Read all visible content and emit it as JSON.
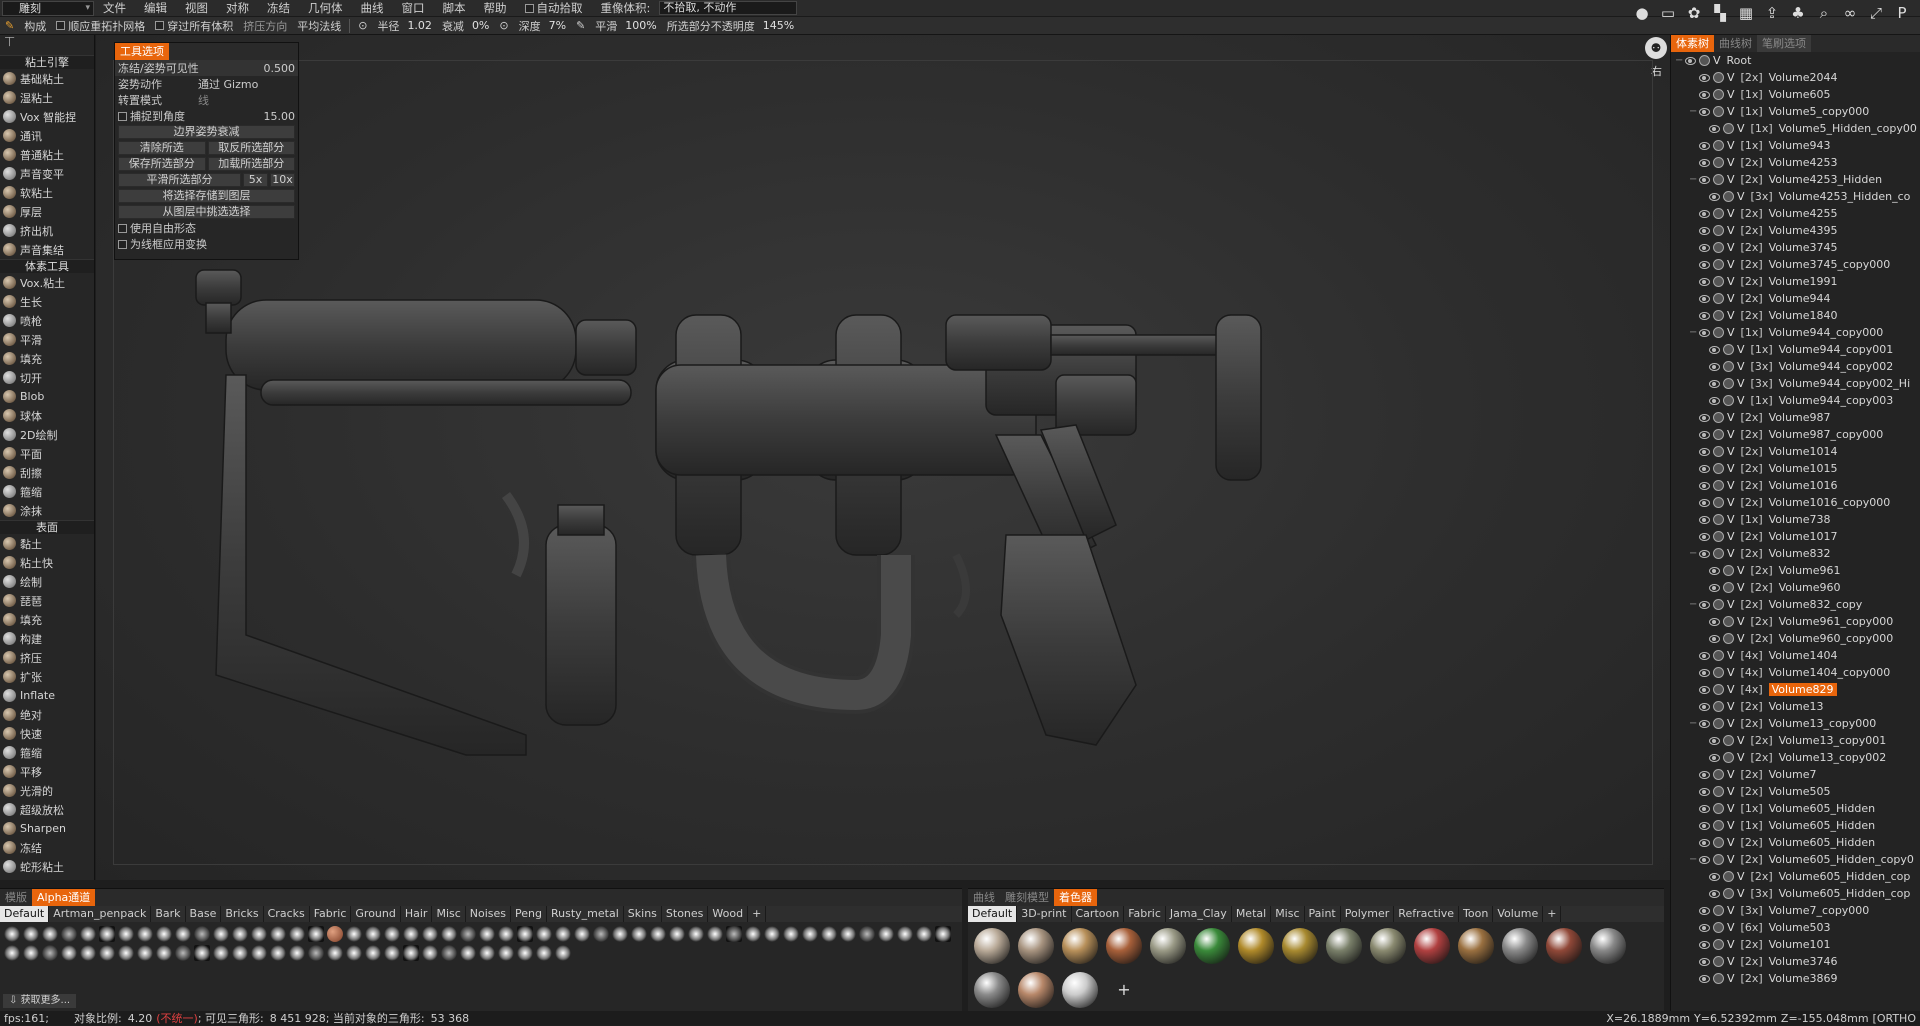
{
  "menubar": {
    "mode": "雕刻",
    "items": [
      "文件",
      "编辑",
      "视图",
      "对称",
      "冻结",
      "几何体",
      "曲线",
      "窗口",
      "脚本",
      "帮助"
    ],
    "auto_pick_label": "自动拾取",
    "reset_volume_label": "重像体积:",
    "reset_volume_value": "不拾取, 不动作"
  },
  "toolopts": {
    "construct": "构成",
    "adapt_topology": "顺应重拓扑网格",
    "through_all": "穿过所有体积",
    "extrude_dir": "挤压方向",
    "average_plane": "平均法线",
    "radius_label": "半径",
    "radius_value": "1.02",
    "falloff_label": "衰减",
    "falloff_value": "0%",
    "depth_label": "深度",
    "depth_value": "7%",
    "smooth_label": "平滑",
    "smooth_value": "100%",
    "opacity_label": "所选部分不透明度",
    "opacity_value": "145%"
  },
  "right_icon_names": [
    "sphere-icon",
    "rect-icon",
    "brush-icon",
    "checker-icon",
    "grid-icon",
    "export-icon",
    "paint-icon",
    "zoom-icon",
    "link-icon",
    "mirror-icon",
    "p-icon"
  ],
  "leftpanel": {
    "clay_header": "粘土引擎",
    "clay_brushes": [
      "基础粘土",
      "湿粘土",
      "Vox 智能捏",
      "通讯",
      "普通粘土",
      "声音变平",
      "软粘土",
      "厚层",
      "挤出机",
      "声音集结"
    ],
    "voxel_header": "体素工具",
    "voxel_brushes": [
      "Vox.粘土",
      "生长",
      "喷枪",
      "平滑",
      "填充",
      "切开",
      "Blob",
      "球体",
      "2D绘制",
      "平面",
      "刮擦",
      "箍缩",
      "涂抹"
    ],
    "surface_header": "表面",
    "surface_brushes": [
      "黏土",
      "粘土快",
      "绘制",
      "琵琶",
      "填充",
      "构建",
      "挤压",
      "扩张",
      "Inflate",
      "绝对",
      "快速",
      "箍缩",
      "平移",
      "光滑的",
      "超级放松",
      "Sharpen",
      "冻结",
      "蛇形粘土"
    ]
  },
  "tool_options_panel": {
    "tab": "工具选项",
    "freeze_label": "冻结/姿势可见性",
    "freeze_value": "0.500",
    "pose_action_label": "姿势动作",
    "pose_action_value": "通过 Gizmo",
    "transform_mode_label": "转置模式",
    "transform_mode_value": "线",
    "snap_angle_label": "捕捉到角度",
    "snap_angle_value": "15.00",
    "border_falloff": "边界姿势衰减",
    "clear_sel": "清除所选",
    "invert_sel": "取反所选部分",
    "save_sel": "保存所选部分",
    "load_sel": "加载所选部分",
    "smooth_sel": "平滑所选部分",
    "x5": "5x",
    "x10": "10x",
    "store_layer": "将选择存储到图层",
    "pick_layer": "从图层中挑选选择",
    "free_form": "使用自由形态",
    "wire_transform": "为线框应用变换"
  },
  "viewport": {
    "view_label": "右"
  },
  "rightpanel": {
    "tabs": [
      "体素树",
      "曲线树",
      "笔刷选项"
    ],
    "root": "Root",
    "items": [
      {
        "mult": "[2x]",
        "name": "Volume2044",
        "indent": 0
      },
      {
        "mult": "[1x]",
        "name": "Volume605",
        "indent": 0
      },
      {
        "mult": "[1x]",
        "name": "Volume5_copy000",
        "indent": 0,
        "collapse": true
      },
      {
        "mult": "[1x]",
        "name": "Volume5_Hidden_copy00",
        "indent": 1
      },
      {
        "mult": "[1x]",
        "name": "Volume943",
        "indent": 0
      },
      {
        "mult": "[2x]",
        "name": "Volume4253",
        "indent": 0
      },
      {
        "mult": "[2x]",
        "name": "Volume4253_Hidden",
        "indent": 0,
        "collapse": true
      },
      {
        "mult": "[3x]",
        "name": "Volume4253_Hidden_co",
        "indent": 1
      },
      {
        "mult": "[2x]",
        "name": "Volume4255",
        "indent": 0
      },
      {
        "mult": "[2x]",
        "name": "Volume4395",
        "indent": 0
      },
      {
        "mult": "[2x]",
        "name": "Volume3745",
        "indent": 0
      },
      {
        "mult": "[2x]",
        "name": "Volume3745_copy000",
        "indent": 0
      },
      {
        "mult": "[2x]",
        "name": "Volume1991",
        "indent": 0
      },
      {
        "mult": "[2x]",
        "name": "Volume944",
        "indent": 0
      },
      {
        "mult": "[2x]",
        "name": "Volume1840",
        "indent": 0
      },
      {
        "mult": "[1x]",
        "name": "Volume944_copy000",
        "indent": 0,
        "collapse": true
      },
      {
        "mult": "[1x]",
        "name": "Volume944_copy001",
        "indent": 1
      },
      {
        "mult": "[3x]",
        "name": "Volume944_copy002",
        "indent": 1
      },
      {
        "mult": "[3x]",
        "name": "Volume944_copy002_Hi",
        "indent": 1
      },
      {
        "mult": "[1x]",
        "name": "Volume944_copy003",
        "indent": 1
      },
      {
        "mult": "[2x]",
        "name": "Volume987",
        "indent": 0
      },
      {
        "mult": "[2x]",
        "name": "Volume987_copy000",
        "indent": 0
      },
      {
        "mult": "[2x]",
        "name": "Volume1014",
        "indent": 0
      },
      {
        "mult": "[2x]",
        "name": "Volume1015",
        "indent": 0
      },
      {
        "mult": "[2x]",
        "name": "Volume1016",
        "indent": 0
      },
      {
        "mult": "[2x]",
        "name": "Volume1016_copy000",
        "indent": 0
      },
      {
        "mult": "[1x]",
        "name": "Volume738",
        "indent": 0
      },
      {
        "mult": "[2x]",
        "name": "Volume1017",
        "indent": 0
      },
      {
        "mult": "[2x]",
        "name": "Volume832",
        "indent": 0,
        "collapse": true
      },
      {
        "mult": "[2x]",
        "name": "Volume961",
        "indent": 1
      },
      {
        "mult": "[2x]",
        "name": "Volume960",
        "indent": 1
      },
      {
        "mult": "[2x]",
        "name": "Volume832_copy",
        "indent": 0,
        "collapse": true
      },
      {
        "mult": "[2x]",
        "name": "Volume961_copy000",
        "indent": 1
      },
      {
        "mult": "[2x]",
        "name": "Volume960_copy000",
        "indent": 1
      },
      {
        "mult": "[4x]",
        "name": "Volume1404",
        "indent": 0
      },
      {
        "mult": "[4x]",
        "name": "Volume1404_copy000",
        "indent": 0
      },
      {
        "mult": "[4x]",
        "name": "Volume829",
        "indent": 0,
        "selected": true
      },
      {
        "mult": "[2x]",
        "name": "Volume13",
        "indent": 0
      },
      {
        "mult": "[2x]",
        "name": "Volume13_copy000",
        "indent": 0,
        "collapse": true
      },
      {
        "mult": "[2x]",
        "name": "Volume13_copy001",
        "indent": 1
      },
      {
        "mult": "[2x]",
        "name": "Volume13_copy002",
        "indent": 1
      },
      {
        "mult": "[2x]",
        "name": "Volume7",
        "indent": 0
      },
      {
        "mult": "[2x]",
        "name": "Volume505",
        "indent": 0
      },
      {
        "mult": "[1x]",
        "name": "Volume605_Hidden",
        "indent": 0
      },
      {
        "mult": "[1x]",
        "name": "Volume605_Hidden",
        "indent": 0
      },
      {
        "mult": "[2x]",
        "name": "Volume605_Hidden",
        "indent": 0
      },
      {
        "mult": "[2x]",
        "name": "Volume605_Hidden_copy0",
        "indent": 0,
        "collapse": true
      },
      {
        "mult": "[2x]",
        "name": "Volume605_Hidden_cop",
        "indent": 1
      },
      {
        "mult": "[3x]",
        "name": "Volume605_Hidden_cop",
        "indent": 1
      },
      {
        "mult": "[3x]",
        "name": "Volume7_copy000",
        "indent": 0
      },
      {
        "mult": "[6x]",
        "name": "Volume503",
        "indent": 0
      },
      {
        "mult": "[2x]",
        "name": "Volume101",
        "indent": 0
      },
      {
        "mult": "[2x]",
        "name": "Volume3746",
        "indent": 0
      },
      {
        "mult": "[2x]",
        "name": "Volume3869",
        "indent": 0
      }
    ]
  },
  "bottom_left": {
    "tabs": [
      "模版",
      "Alpha通道"
    ],
    "categories": [
      "Default",
      "Artman_penpack",
      "Bark",
      "Base",
      "Bricks",
      "Cracks",
      "Fabric",
      "Ground",
      "Hair",
      "Misc",
      "Noises",
      "Peng",
      "Rusty_metal",
      "Skins",
      "Stones",
      "Wood",
      "+"
    ],
    "get_more": "获取更多..."
  },
  "bottom_right": {
    "tabs": [
      "曲线",
      "雕刻模型",
      "着色器"
    ],
    "categories": [
      "Default",
      "3D-print",
      "Cartoon",
      "Fabric",
      "Jama_Clay",
      "Metal",
      "Misc",
      "Paint",
      "Polymer",
      "Refractive",
      "Toon",
      "Volume",
      "+"
    ],
    "add": "+"
  },
  "statusbar": {
    "fps": "fps:161;",
    "scale_label": "对象比例:",
    "scale_value": "4.20",
    "scale_note": "(不统一)",
    "visible_tris_label": "; 可见三角形:",
    "visible_tris": "8 451 928",
    "current_tris_label": "; 当前对象的三角形:",
    "current_tris": "53 368",
    "x": "X=26.1889mm",
    "y": "Y=6.52392mm",
    "z": "Z=-155.048mm",
    "ortho": "[ORTHO"
  },
  "colors": {
    "accent": "#e8650c",
    "bg": "#1e1e1e",
    "panel": "#262626"
  }
}
